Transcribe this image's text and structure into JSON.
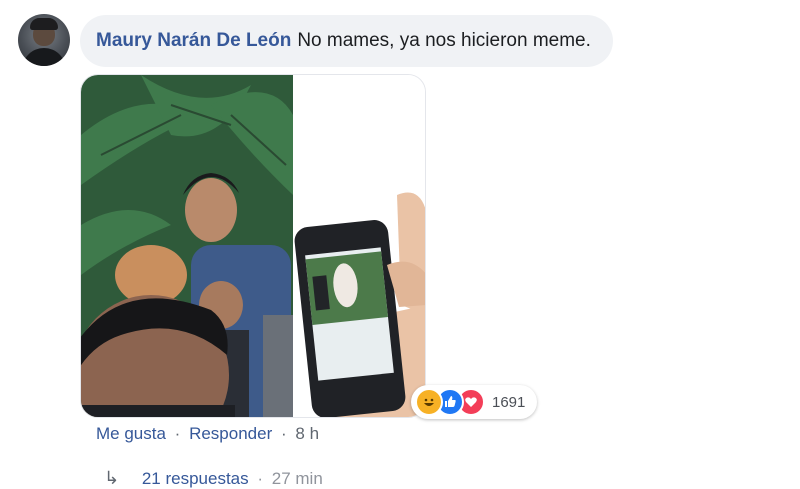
{
  "comment": {
    "author": "Maury Narán De León",
    "text": "No mames, ya nos hicieron meme."
  },
  "reactions": {
    "icons": [
      "haha-icon",
      "like-icon",
      "love-icon"
    ],
    "count": "1691",
    "colors": {
      "haha": "#f7b125",
      "like": "#2078f4",
      "love": "#f33e58"
    }
  },
  "actions": {
    "like": "Me gusta",
    "separator": "·",
    "reply": "Responder",
    "time": "8 h"
  },
  "replies": {
    "icon": "reply-arrow-icon",
    "label": "21 respuestas",
    "separator": "·",
    "time": "27 min"
  },
  "theme": {
    "link": "#365899",
    "bubble": "#f0f2f5",
    "text": "#1c1e21",
    "muted": "#606770"
  }
}
